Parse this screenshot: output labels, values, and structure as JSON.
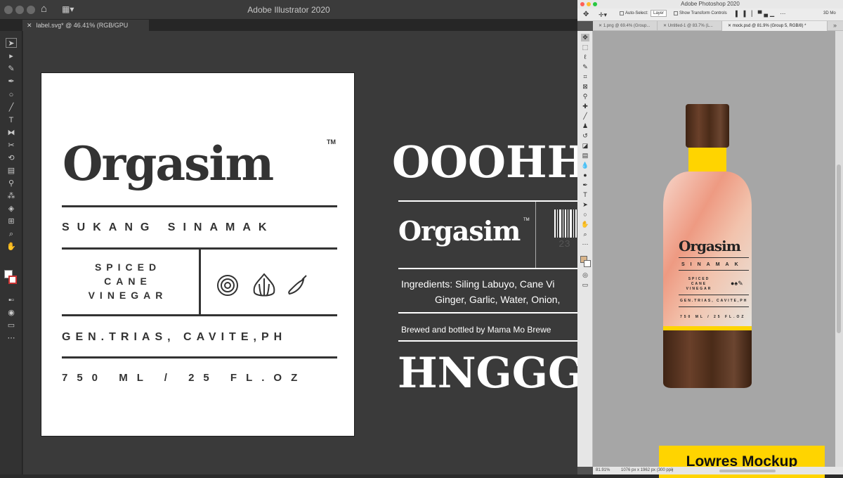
{
  "illustrator": {
    "window_title": "Adobe Illustrator 2020",
    "doc_tab": "label.svg* @ 46.41% (RGB/GPU Preview)",
    "artboard": {
      "brand": "Orgasim",
      "tm": "TM",
      "subtitle": "SUKANG SINAMAK",
      "product": [
        "SPICED",
        "CANE",
        "VINEGAR"
      ],
      "origin": "GEN.TRIAS, CAVITE,PH",
      "volume": "750 ML / 25 FL.OZ"
    },
    "back_label": {
      "headline": "OOOHH",
      "brand": "Orgasim",
      "tm": "TM",
      "barcode_digits": "23",
      "ingredients_1": "Ingredients: Siling Labuyo, Cane Vi",
      "ingredients_2": "Ginger, Garlic, Water, Onion,",
      "brewed": "Brewed and bottled by Mama Mo Brewe",
      "footer_word": "HNGGG"
    }
  },
  "photoshop": {
    "window_title": "Adobe Photoshop 2020",
    "options": {
      "auto_select": "Auto-Select:",
      "layer": "Layer",
      "transform": "Show Transform Controls",
      "three_d": "3D Mo"
    },
    "tabs": [
      "1.png @ 69.4% (Group...",
      "Untitled-1 @ 83.7% (L...",
      "mock.psd @ 81.9% (Group 5, RGB/8) *"
    ],
    "status_zoom": "81.91%",
    "status_doc": "1076 px x 1962 px (300 ppi)",
    "bottle": {
      "brand": "Orgasim",
      "sub": "SINAMAK",
      "product": [
        "SPICED",
        "CANE",
        "VINEGAR"
      ],
      "origin": "GEN.TRIAS, CAVITE,PH",
      "volume": "750 ML / 25 FL.OZ"
    },
    "mockup_label": "Lowres Mockup"
  },
  "colors": {
    "accent_yellow": "#ffd400",
    "wood": "#5a3520",
    "ink": "#333333"
  }
}
